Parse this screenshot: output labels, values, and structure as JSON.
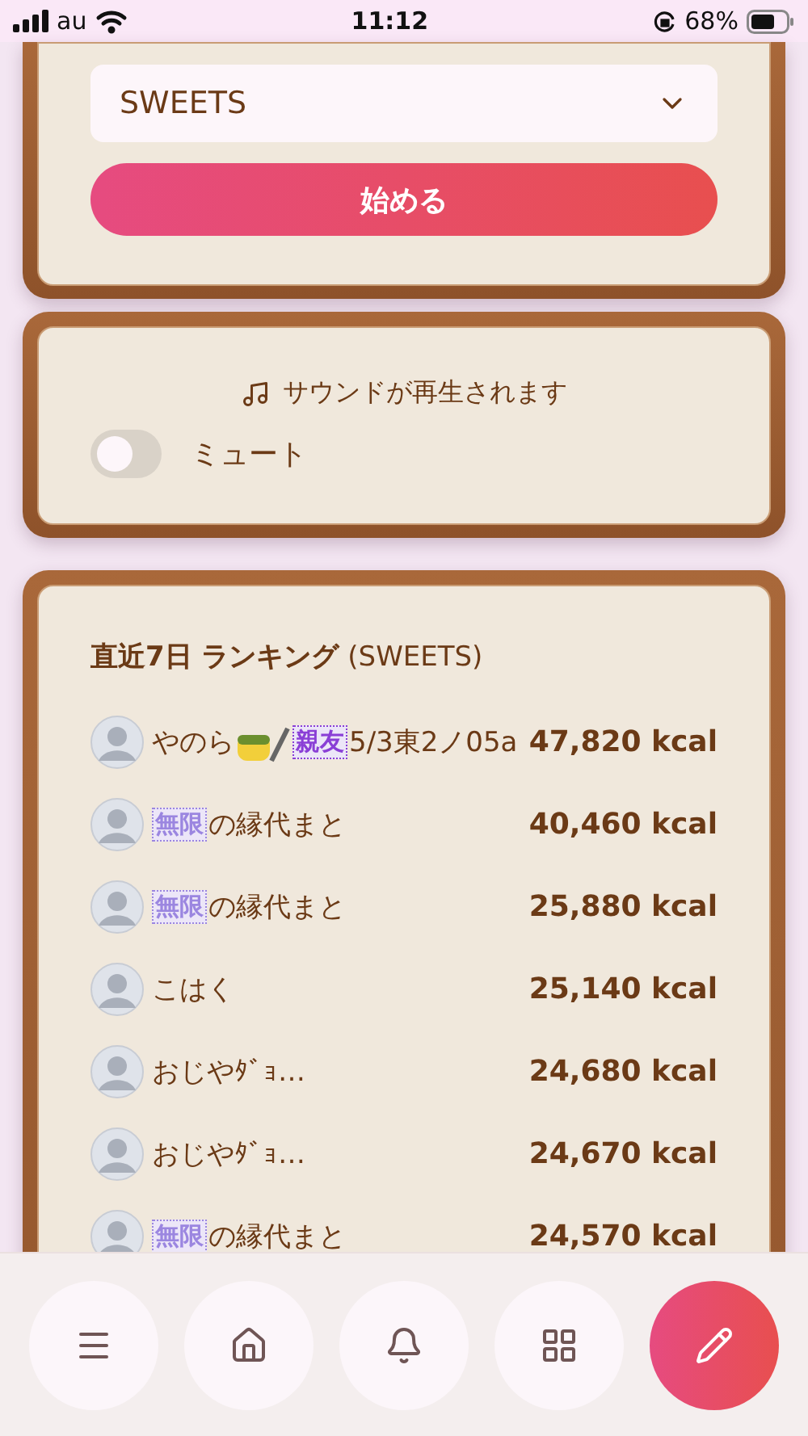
{
  "status_bar": {
    "carrier": "au",
    "time": "11:12",
    "battery": "68%"
  },
  "game_select": {
    "value": "SWEETS"
  },
  "start_button": "始める",
  "sound": {
    "message": "サウンドが再生されます",
    "mute_label": "ミュート",
    "muted": false
  },
  "ranking": {
    "title": "**直近7日 ランキング** (SWEETS)",
    "rows": [
      {
        "name": [
          {
            "kind": "text",
            "text": "やのら"
          },
          {
            "kind": "sticker"
          },
          {
            "kind": "badge",
            "text": "親友",
            "color": "#8a3fd6"
          },
          {
            "kind": "text",
            "text": "5/3東2ノ05a"
          }
        ],
        "score": "47,820 kcal"
      },
      {
        "name": [
          {
            "kind": "badge",
            "text": "無限",
            "color": "#9b86e0"
          },
          {
            "kind": "text",
            "text": "の縁代まと"
          }
        ],
        "score": "40,460 kcal"
      },
      {
        "name": [
          {
            "kind": "badge",
            "text": "無限",
            "color": "#9b86e0"
          },
          {
            "kind": "text",
            "text": "の縁代まと"
          }
        ],
        "score": "25,880 kcal"
      },
      {
        "name": [
          {
            "kind": "text",
            "text": "こはく"
          }
        ],
        "score": "25,140 kcal"
      },
      {
        "name": [
          {
            "kind": "text",
            "text": "おじやﾀﾞｮ…"
          }
        ],
        "score": "24,680 kcal"
      },
      {
        "name": [
          {
            "kind": "text",
            "text": "おじやﾀﾞｮ…"
          }
        ],
        "score": "24,670 kcal"
      },
      {
        "name": [
          {
            "kind": "badge",
            "text": "無限",
            "color": "#9b86e0"
          },
          {
            "kind": "text",
            "text": "の縁代まと"
          }
        ],
        "score": "24,570 kcal"
      }
    ]
  },
  "nav": [
    {
      "kind": "menu",
      "primary": false
    },
    {
      "kind": "home",
      "primary": false
    },
    {
      "kind": "bell",
      "primary": false
    },
    {
      "kind": "apps",
      "primary": false
    },
    {
      "kind": "edit",
      "primary": true
    }
  ]
}
